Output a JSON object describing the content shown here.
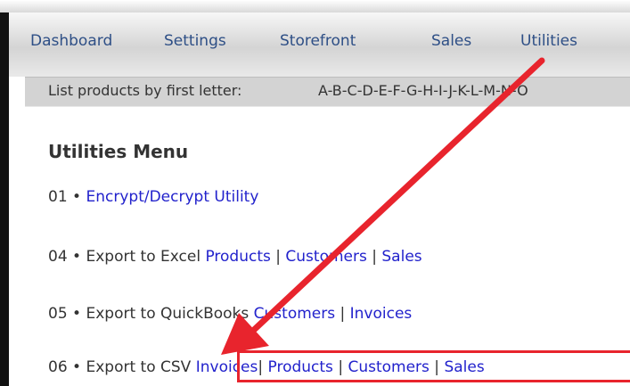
{
  "nav": {
    "items": [
      {
        "label": "Dashboard"
      },
      {
        "label": "Settings"
      },
      {
        "label": "Storefront"
      },
      {
        "label": "Sales"
      },
      {
        "label": "Utilities"
      }
    ]
  },
  "letter_bar": {
    "prefix": "List products by first letter:",
    "letters": "A-B-C-D-E-F-G-H-I-J-K-L-M-N-O"
  },
  "page": {
    "title": "Utilities Menu"
  },
  "menu": {
    "item_01": {
      "number": "01",
      "bullet": "•",
      "link": "Encrypt/Decrypt Utility"
    },
    "item_04": {
      "number": "04",
      "bullet": "•",
      "text": "Export to Excel",
      "links": [
        "Products",
        "Customers",
        "Sales"
      ],
      "sep": "|"
    },
    "item_05": {
      "number": "05",
      "bullet": "•",
      "text": "Export to QuickBooks",
      "links": [
        "Customers",
        "Invoices"
      ],
      "sep": "|"
    },
    "item_06": {
      "number": "06",
      "bullet": "•",
      "text": "Export to CSV",
      "links": [
        "Invoices",
        "Products",
        "Customers",
        "Sales"
      ],
      "sep": "|"
    }
  },
  "annotation": {
    "arrow_color": "#e8242d",
    "box_color": "#e8242d"
  }
}
